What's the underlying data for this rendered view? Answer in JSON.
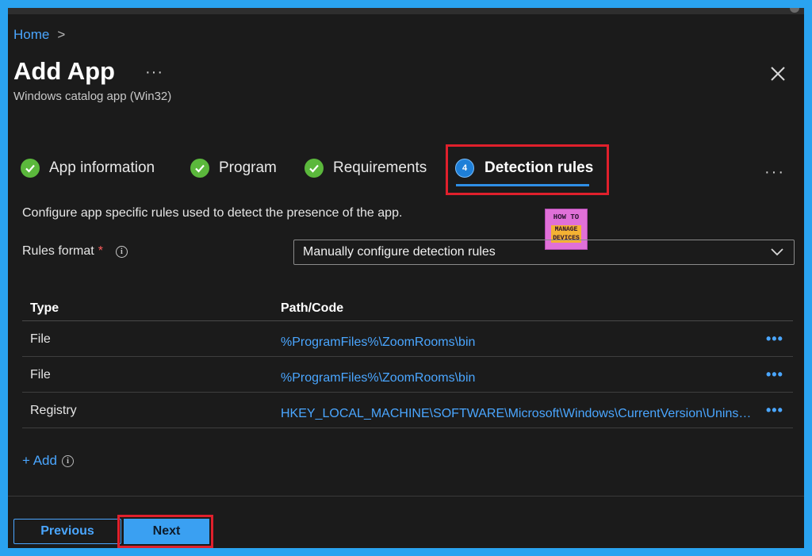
{
  "breadcrumb": {
    "home": "Home",
    "separator": ">"
  },
  "header": {
    "title": "Add App",
    "more": "···",
    "subtitle": "Windows catalog app (Win32)"
  },
  "tabs": [
    {
      "label": "App information",
      "state": "complete"
    },
    {
      "label": "Program",
      "state": "complete"
    },
    {
      "label": "Requirements",
      "state": "complete"
    },
    {
      "label": "Detection rules",
      "state": "active",
      "step": "4"
    }
  ],
  "tabs_more": "···",
  "description": "Configure app specific rules used to detect the presence of the app.",
  "watermark": {
    "line1": "HOW TO",
    "line2": "MANAGE DEVICES"
  },
  "rules_format": {
    "label": "Rules format",
    "required_mark": "*",
    "info_icon": "i",
    "selected": "Manually configure detection rules"
  },
  "table": {
    "headers": {
      "type": "Type",
      "path": "Path/Code"
    },
    "rows": [
      {
        "type": "File",
        "path": "%ProgramFiles%\\ZoomRooms\\bin"
      },
      {
        "type": "File",
        "path": "%ProgramFiles%\\ZoomRooms\\bin"
      },
      {
        "type": "Registry",
        "path": "HKEY_LOCAL_MACHINE\\SOFTWARE\\Microsoft\\Windows\\CurrentVersion\\Uninstall"
      }
    ],
    "row_more": "•••"
  },
  "add": {
    "label": "+ Add",
    "info_icon": "i"
  },
  "footer": {
    "previous": "Previous",
    "next": "Next"
  },
  "colors": {
    "accent": "#4aa6ff",
    "success": "#5bb83c",
    "highlight": "#e0202c",
    "background": "#1b1b1b",
    "frame": "#2aa3f0"
  }
}
